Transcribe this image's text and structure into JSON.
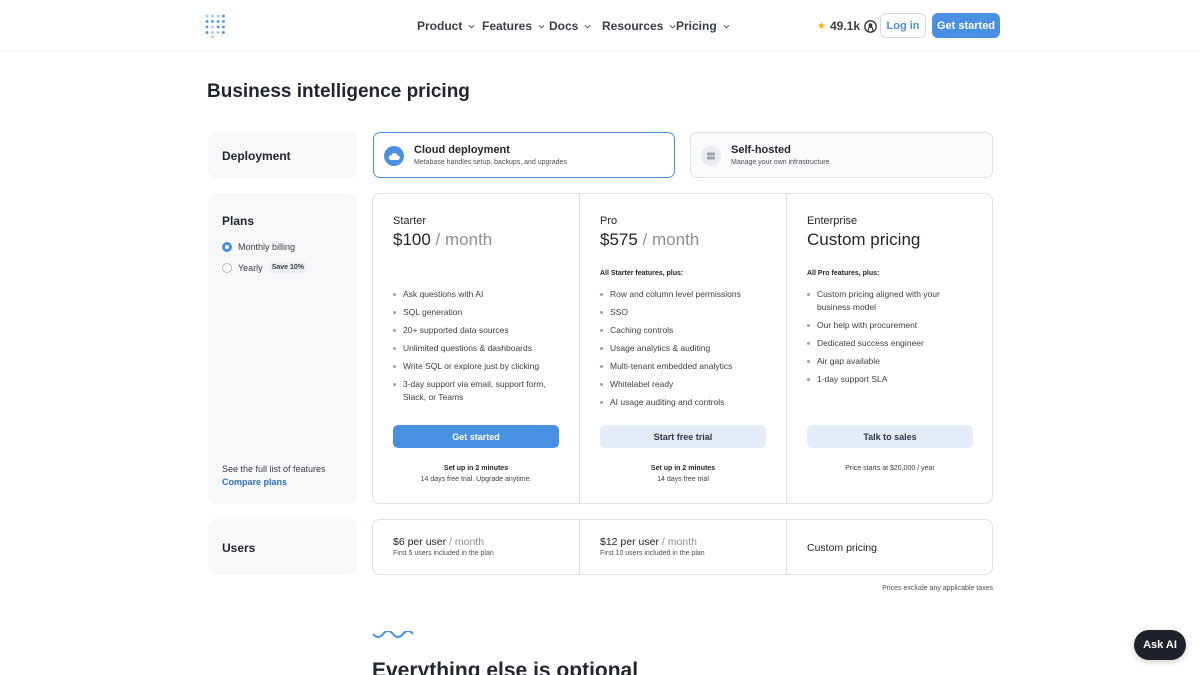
{
  "header": {
    "nav": [
      {
        "label": "Product"
      },
      {
        "label": "Features"
      },
      {
        "label": "Docs"
      },
      {
        "label": "Resources"
      },
      {
        "label": "Pricing"
      }
    ],
    "github_stars": "49.1k",
    "login_label": "Log in",
    "get_started_label": "Get started"
  },
  "page_title": "Business intelligence pricing",
  "deployment": {
    "label": "Deployment",
    "options": [
      {
        "title": "Cloud deployment",
        "subtitle": "Metabase handles setup, backups, and upgrades",
        "selected": true
      },
      {
        "title": "Self-hosted",
        "subtitle": "Manage your own infrastructure",
        "selected": false
      }
    ]
  },
  "plans_panel": {
    "label": "Plans",
    "billing": [
      {
        "label": "Monthly billing",
        "selected": true
      },
      {
        "label": "Yearly",
        "badge": "Save 10%",
        "selected": false
      }
    ],
    "see_full": "See the full list of features",
    "compare_link": "Compare plans"
  },
  "plans": [
    {
      "name": "Starter",
      "price": "$100",
      "period": " / month",
      "includes": "",
      "features": [
        "Ask questions with AI",
        "SQL generation",
        "20+ supported data sources",
        "Unlimited questions & dashboards",
        "Write SQL or explore just by clicking",
        "3-day support via email, support form, Slack, or Teams"
      ],
      "cta": "Get started",
      "note_bold": "Set up in 2 minutes",
      "note": "14 days free trial. Upgrade anytime."
    },
    {
      "name": "Pro",
      "price": "$575",
      "period": " / month",
      "includes": "All Starter features, plus:",
      "features": [
        "Row and column level permissions",
        "SSO",
        "Caching controls",
        "Usage analytics & auditing",
        "Multi-tenant embedded analytics",
        "Whitelabel ready",
        "AI usage auditing and controls"
      ],
      "cta": "Start free trial",
      "note_bold": "Set up in 2 minutes",
      "note": "14 days free trial"
    },
    {
      "name": "Enterprise",
      "price": "Custom pricing",
      "period": "",
      "includes": "All Pro features, plus:",
      "features": [
        "Custom pricing aligned with your business model",
        "Our help with procurement",
        "Dedicated success engineer",
        "Air gap available",
        "1-day support SLA"
      ],
      "cta": "Talk to sales",
      "note_bold": "",
      "note": "Price starts at $20,000 / year"
    }
  ],
  "users": {
    "label": "Users",
    "cols": [
      {
        "price": "$6 per user",
        "period": " / month",
        "sub": "First 5 users included in the plan"
      },
      {
        "price": "$12 per user",
        "period": " / month",
        "sub": "First 10 users included in the plan"
      },
      {
        "price": "Custom pricing",
        "period": "",
        "sub": ""
      }
    ]
  },
  "tax_note": "Prices exclude any applicable taxes",
  "bottom_heading": "Everything else is optional",
  "ask_ai_label": "Ask AI",
  "colors": {
    "accent": "#4a90e2",
    "accent_light": "#e3ecf7"
  }
}
